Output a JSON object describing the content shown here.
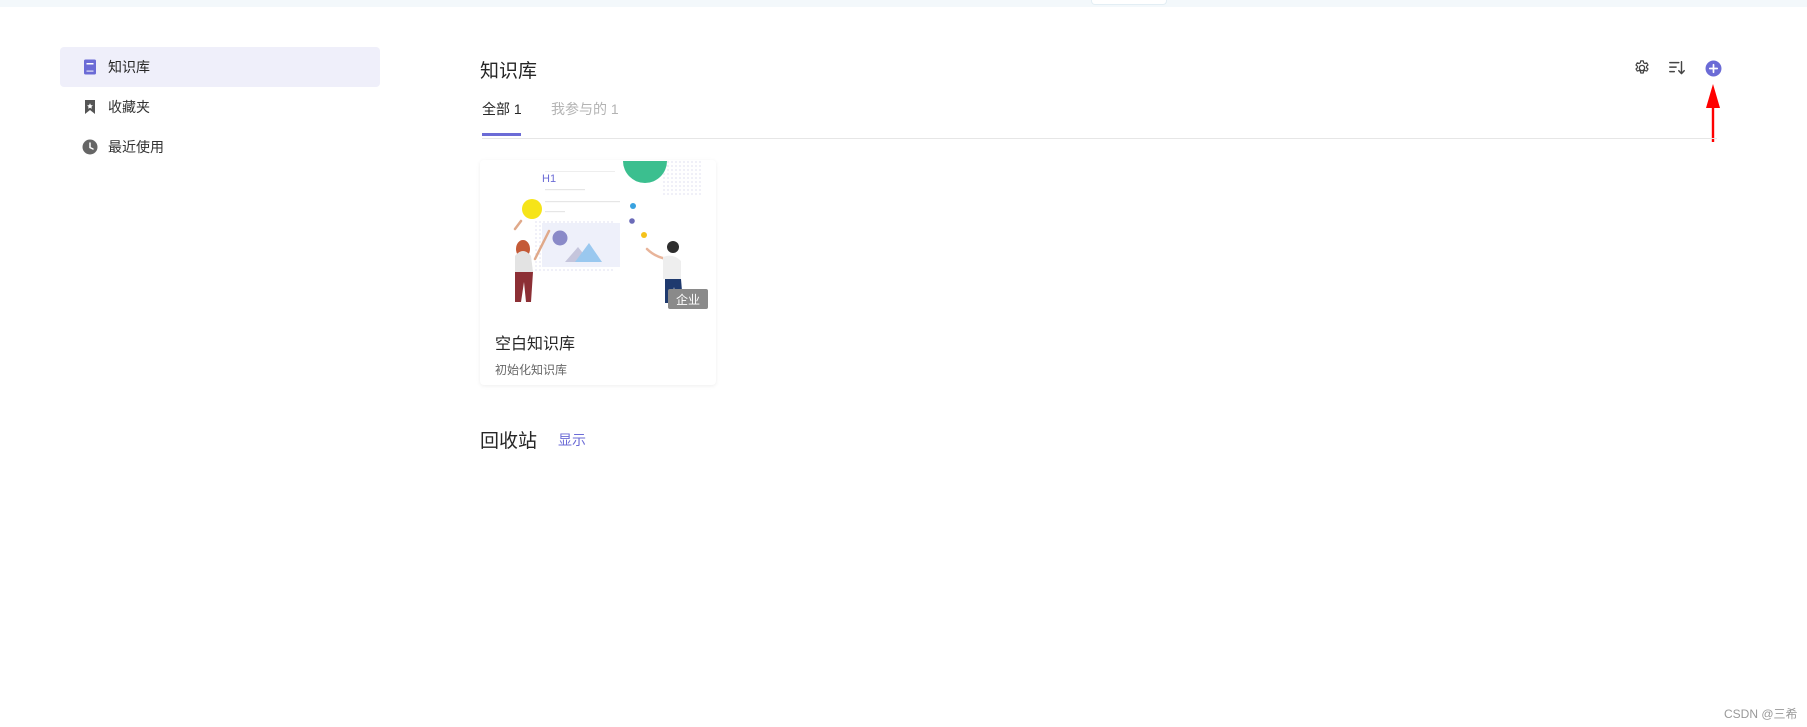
{
  "sidebar": {
    "items": [
      {
        "label": "知识库",
        "icon": "book-icon",
        "active": true
      },
      {
        "label": "收藏夹",
        "icon": "bookmark-icon",
        "active": false
      },
      {
        "label": "最近使用",
        "icon": "clock-icon",
        "active": false
      }
    ]
  },
  "header": {
    "title": "知识库",
    "icons": [
      "gear-icon",
      "sort-icon",
      "plus-circle-icon"
    ]
  },
  "tabs": [
    {
      "label": "全部 1",
      "active": true
    },
    {
      "label": "我参与的 1",
      "active": false
    }
  ],
  "card": {
    "badge": "企业",
    "title": "空白知识库",
    "desc": "初始化知识库",
    "illustration_text": "H1"
  },
  "recycle": {
    "title": "回收站",
    "show_label": "显示"
  },
  "watermark": "CSDN @三希",
  "colors": {
    "accent": "#6b6bd6",
    "active_bg": "#efeffa",
    "annotation_arrow": "#ff0000"
  }
}
